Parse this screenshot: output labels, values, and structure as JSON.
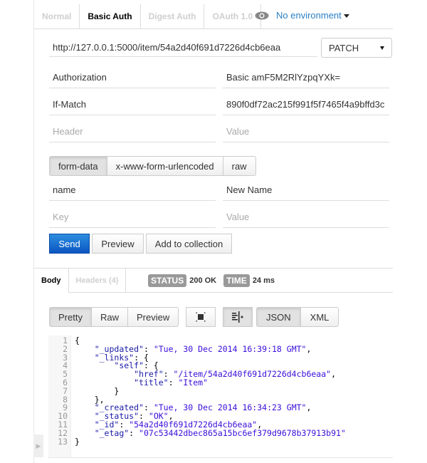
{
  "auth_tabs": [
    {
      "label": "Normal",
      "active": false
    },
    {
      "label": "Basic Auth",
      "active": true
    },
    {
      "label": "Digest Auth",
      "active": false
    },
    {
      "label": "OAuth 1.0",
      "active": false
    }
  ],
  "environment": {
    "icon": "eye-icon",
    "label": "No environment"
  },
  "request": {
    "url": "http://127.0.0.1:5000/item/54a2d40f691d7226d4cb6eaa",
    "method": "PATCH"
  },
  "headers": [
    {
      "key": "Authorization",
      "value": "Basic amF5M2RlYzpqYXk="
    },
    {
      "key": "If-Match",
      "value": "890f0df72ac215f991f5f7465f4a9bffd3c"
    }
  ],
  "header_placeholder": {
    "key": "Header",
    "value": "Value"
  },
  "body_types": [
    {
      "label": "form-data",
      "active": true
    },
    {
      "label": "x-www-form-urlencoded",
      "active": false
    },
    {
      "label": "raw",
      "active": false
    }
  ],
  "form_fields": [
    {
      "key": "name",
      "value": "New Name"
    }
  ],
  "form_placeholder": {
    "key": "Key",
    "value": "Value"
  },
  "actions": {
    "send": "Send",
    "preview": "Preview",
    "add_to_collection": "Add to collection"
  },
  "response": {
    "tabs": [
      {
        "label": "Body",
        "active": true
      },
      {
        "label": "Headers (4)",
        "active": false
      }
    ],
    "status_label": "STATUS",
    "status_value": "200 OK",
    "time_label": "TIME",
    "time_value": "24 ms",
    "view_modes": [
      {
        "label": "Pretty",
        "active": true
      },
      {
        "label": "Raw",
        "active": false
      },
      {
        "label": "Preview",
        "active": false
      }
    ],
    "formats": [
      {
        "label": "JSON",
        "active": true
      },
      {
        "label": "XML",
        "active": false
      }
    ],
    "icons": {
      "fullscreen": "fullscreen-icon",
      "wrap": "wrap-lines-icon"
    },
    "lines": [
      "{",
      "    \"_updated\": \"Tue, 30 Dec 2014 16:39:18 GMT\",",
      "    \"_links\": {",
      "        \"self\": {",
      "            \"href\": \"/item/54a2d40f691d7226d4cb6eaa\",",
      "            \"title\": \"Item\"",
      "        }",
      "    },",
      "    \"_created\": \"Tue, 30 Dec 2014 16:34:23 GMT\",",
      "    \"_status\": \"OK\",",
      "    \"_id\": \"54a2d40f691d7226d4cb6eaa\",",
      "    \"_etag\": \"07c53442dbec865a15bc6ef379d9678b37913b91\"",
      "}"
    ]
  }
}
